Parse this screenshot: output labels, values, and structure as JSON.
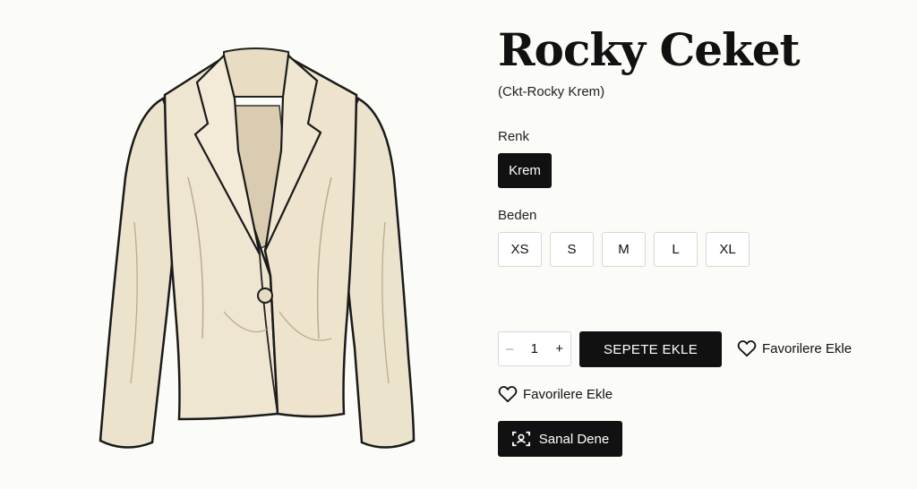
{
  "product": {
    "title": "Rocky Ceket",
    "sku": "(Ckt-Rocky Krem)",
    "image_alt": "Rocky Ceket",
    "color_label": "Renk",
    "colors": [
      "Krem"
    ],
    "selected_color": "Krem",
    "size_label": "Beden",
    "sizes": [
      "XS",
      "S",
      "M",
      "L",
      "XL"
    ]
  },
  "cart": {
    "minus": "–",
    "quantity": "1",
    "plus": "+",
    "add_to_cart": "SEPETE EKLE"
  },
  "favorites": {
    "label_inline": "Favorilere Ekle",
    "label_below": "Favorilere Ekle"
  },
  "virtual_try": {
    "label": "Sanal Dene"
  },
  "icons": {
    "heart": "heart-icon",
    "scan": "scan-icon"
  },
  "colors": {
    "background": "#fbfbf8",
    "primary": "#111111",
    "jacket": "#ece3cd"
  }
}
